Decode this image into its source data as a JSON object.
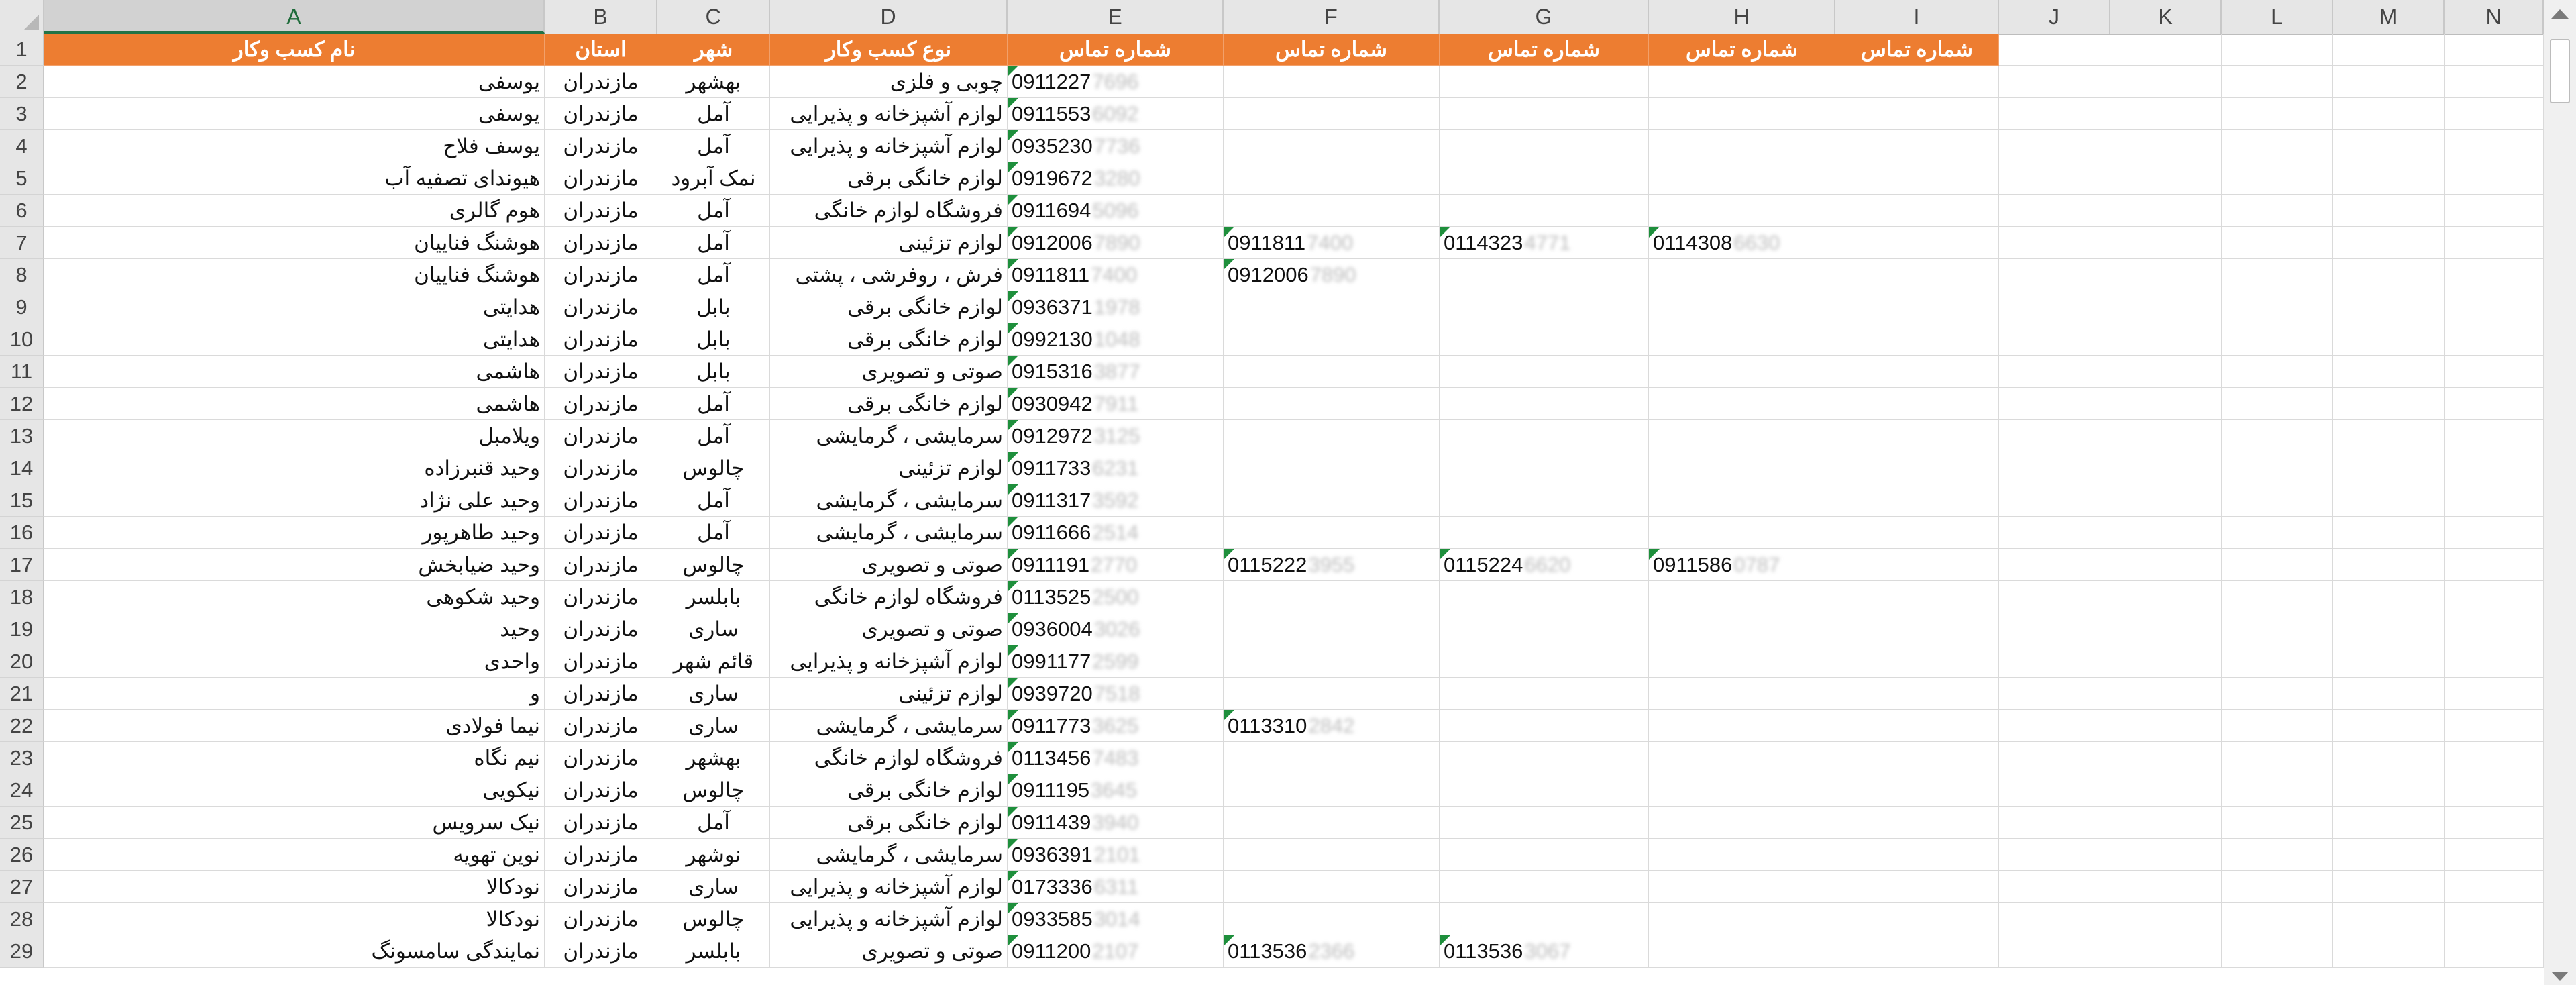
{
  "columns": [
    "A",
    "B",
    "C",
    "D",
    "E",
    "F",
    "G",
    "H",
    "I",
    "J",
    "K",
    "L",
    "M",
    "N"
  ],
  "header_row": {
    "row_number": "1",
    "A": "نام کسب وکار",
    "B": "استان",
    "C": "شهر",
    "D": "نوع کسب وکار",
    "E": "شماره تماس",
    "F": "شماره تماس",
    "G": "شماره تماس",
    "H": "شماره تماس",
    "I": "شماره تماس"
  },
  "rows": [
    {
      "n": "2",
      "A": "یوسفی",
      "B": "مازندران",
      "C": "بهشهر",
      "D": "چوبی و فلزی",
      "E": "0911227",
      "Eb": "7696",
      "F": "",
      "Fb": "",
      "G": "",
      "Gb": "",
      "H": "",
      "Hb": ""
    },
    {
      "n": "3",
      "A": "یوسفی",
      "B": "مازندران",
      "C": "آمل",
      "D": "لوازم آشپزخانه و پذیرایی",
      "E": "0911553",
      "Eb": "6092",
      "F": "",
      "Fb": "",
      "G": "",
      "Gb": "",
      "H": "",
      "Hb": ""
    },
    {
      "n": "4",
      "A": "یوسف فلاح",
      "B": "مازندران",
      "C": "آمل",
      "D": "لوازم آشپزخانه و پذیرایی",
      "E": "0935230",
      "Eb": "7736",
      "F": "",
      "Fb": "",
      "G": "",
      "Gb": "",
      "H": "",
      "Hb": ""
    },
    {
      "n": "5",
      "A": "هیوندای تصفیه آب",
      "B": "مازندران",
      "C": "نمک آبرود",
      "D": "لوازم خانگی برقی",
      "E": "0919672",
      "Eb": "3280",
      "F": "",
      "Fb": "",
      "G": "",
      "Gb": "",
      "H": "",
      "Hb": ""
    },
    {
      "n": "6",
      "A": "هوم گالری",
      "B": "مازندران",
      "C": "آمل",
      "D": "فروشگاه لوازم خانگی",
      "E": "0911694",
      "Eb": "5096",
      "F": "",
      "Fb": "",
      "G": "",
      "Gb": "",
      "H": "",
      "Hb": ""
    },
    {
      "n": "7",
      "A": "هوشنگ فناییان",
      "B": "مازندران",
      "C": "آمل",
      "D": "لوازم تزئینی",
      "E": "0912006",
      "Eb": "7890",
      "F": "0911811",
      "Fb": "7400",
      "G": "0114323",
      "Gb": "4771",
      "H": "0114308",
      "Hb": "6630"
    },
    {
      "n": "8",
      "A": "هوشنگ فناییان",
      "B": "مازندران",
      "C": "آمل",
      "D": "فرش ، روفرشی ، پشتی",
      "E": "0911811",
      "Eb": "7400",
      "F": "0912006",
      "Fb": "7890",
      "G": "",
      "Gb": "",
      "H": "",
      "Hb": ""
    },
    {
      "n": "9",
      "A": "هدایتی",
      "B": "مازندران",
      "C": "بابل",
      "D": "لوازم خانگی برقی",
      "E": "0936371",
      "Eb": "1978",
      "F": "",
      "Fb": "",
      "G": "",
      "Gb": "",
      "H": "",
      "Hb": ""
    },
    {
      "n": "10",
      "A": "هدایتی",
      "B": "مازندران",
      "C": "بابل",
      "D": "لوازم خانگی برقی",
      "E": "0992130",
      "Eb": "1048",
      "F": "",
      "Fb": "",
      "G": "",
      "Gb": "",
      "H": "",
      "Hb": ""
    },
    {
      "n": "11",
      "A": "هاشمی",
      "B": "مازندران",
      "C": "بابل",
      "D": "صوتی و تصویری",
      "E": "0915316",
      "Eb": "3877",
      "F": "",
      "Fb": "",
      "G": "",
      "Gb": "",
      "H": "",
      "Hb": ""
    },
    {
      "n": "12",
      "A": "هاشمی",
      "B": "مازندران",
      "C": "آمل",
      "D": "لوازم خانگی برقی",
      "E": "0930942",
      "Eb": "7911",
      "F": "",
      "Fb": "",
      "G": "",
      "Gb": "",
      "H": "",
      "Hb": ""
    },
    {
      "n": "13",
      "A": "ویلامبل",
      "B": "مازندران",
      "C": "آمل",
      "D": "سرمایشی ، گرمایشی",
      "E": "0912972",
      "Eb": "3125",
      "F": "",
      "Fb": "",
      "G": "",
      "Gb": "",
      "H": "",
      "Hb": ""
    },
    {
      "n": "14",
      "A": "وحید قنبرزاده",
      "B": "مازندران",
      "C": "چالوس",
      "D": "لوازم تزئینی",
      "E": "0911733",
      "Eb": "6231",
      "F": "",
      "Fb": "",
      "G": "",
      "Gb": "",
      "H": "",
      "Hb": ""
    },
    {
      "n": "15",
      "A": "وحید علی نژاد",
      "B": "مازندران",
      "C": "آمل",
      "D": "سرمایشی ، گرمایشی",
      "E": "0911317",
      "Eb": "3592",
      "F": "",
      "Fb": "",
      "G": "",
      "Gb": "",
      "H": "",
      "Hb": ""
    },
    {
      "n": "16",
      "A": "وحید طاهرپور",
      "B": "مازندران",
      "C": "آمل",
      "D": "سرمایشی ، گرمایشی",
      "E": "0911666",
      "Eb": "2514",
      "F": "",
      "Fb": "",
      "G": "",
      "Gb": "",
      "H": "",
      "Hb": ""
    },
    {
      "n": "17",
      "A": "وحید ضیابخش",
      "B": "مازندران",
      "C": "چالوس",
      "D": "صوتی و تصویری",
      "E": "0911191",
      "Eb": "2770",
      "F": "0115222",
      "Fb": "3955",
      "G": "0115224",
      "Gb": "6620",
      "H": "0911586",
      "Hb": "0787"
    },
    {
      "n": "18",
      "A": "وحید شکوهی",
      "B": "مازندران",
      "C": "بابلسر",
      "D": "فروشگاه لوازم خانگی",
      "E": "0113525",
      "Eb": "2500",
      "F": "",
      "Fb": "",
      "G": "",
      "Gb": "",
      "H": "",
      "Hb": ""
    },
    {
      "n": "19",
      "A": "وحید",
      "B": "مازندران",
      "C": "ساری",
      "D": "صوتی و تصویری",
      "E": "0936004",
      "Eb": "3026",
      "F": "",
      "Fb": "",
      "G": "",
      "Gb": "",
      "H": "",
      "Hb": ""
    },
    {
      "n": "20",
      "A": "واحدی",
      "B": "مازندران",
      "C": "قائم شهر",
      "D": "لوازم آشپزخانه و پذیرایی",
      "E": "0991177",
      "Eb": "2599",
      "F": "",
      "Fb": "",
      "G": "",
      "Gb": "",
      "H": "",
      "Hb": ""
    },
    {
      "n": "21",
      "A": "و",
      "B": "مازندران",
      "C": "ساری",
      "D": "لوازم تزئینی",
      "E": "0939720",
      "Eb": "7518",
      "F": "",
      "Fb": "",
      "G": "",
      "Gb": "",
      "H": "",
      "Hb": ""
    },
    {
      "n": "22",
      "A": "نیما فولادی",
      "B": "مازندران",
      "C": "ساری",
      "D": "سرمایشی ، گرمایشی",
      "E": "0911773",
      "Eb": "3625",
      "F": "0113310",
      "Fb": "2842",
      "G": "",
      "Gb": "",
      "H": "",
      "Hb": ""
    },
    {
      "n": "23",
      "A": "نیم نگاه",
      "B": "مازندران",
      "C": "بهشهر",
      "D": "فروشگاه لوازم خانگی",
      "E": "0113456",
      "Eb": "7483",
      "F": "",
      "Fb": "",
      "G": "",
      "Gb": "",
      "H": "",
      "Hb": ""
    },
    {
      "n": "24",
      "A": "نیکویی",
      "B": "مازندران",
      "C": "چالوس",
      "D": "لوازم خانگی برقی",
      "E": "0911195",
      "Eb": "3645",
      "F": "",
      "Fb": "",
      "G": "",
      "Gb": "",
      "H": "",
      "Hb": ""
    },
    {
      "n": "25",
      "A": "نیک سرویس",
      "B": "مازندران",
      "C": "آمل",
      "D": "لوازم خانگی برقی",
      "E": "0911439",
      "Eb": "3940",
      "F": "",
      "Fb": "",
      "G": "",
      "Gb": "",
      "H": "",
      "Hb": ""
    },
    {
      "n": "26",
      "A": "نوین تهویه",
      "B": "مازندران",
      "C": "نوشهر",
      "D": "سرمایشی ، گرمایشی",
      "E": "0936391",
      "Eb": "2101",
      "F": "",
      "Fb": "",
      "G": "",
      "Gb": "",
      "H": "",
      "Hb": ""
    },
    {
      "n": "27",
      "A": "نودکالا",
      "B": "مازندران",
      "C": "ساری",
      "D": "لوازم آشپزخانه و پذیرایی",
      "E": "0173336",
      "Eb": "6311",
      "F": "",
      "Fb": "",
      "G": "",
      "Gb": "",
      "H": "",
      "Hb": ""
    },
    {
      "n": "28",
      "A": "نودکالا",
      "B": "مازندران",
      "C": "چالوس",
      "D": "لوازم آشپزخانه و پذیرایی",
      "E": "0933585",
      "Eb": "3014",
      "F": "",
      "Fb": "",
      "G": "",
      "Gb": "",
      "H": "",
      "Hb": ""
    },
    {
      "n": "29",
      "A": "نمایندگی سامسونگ",
      "B": "مازندران",
      "C": "بابلسر",
      "D": "صوتی و تصویری",
      "E": "0911200",
      "Eb": "2107",
      "F": "0113536",
      "Fb": "2366",
      "G": "0113536",
      "Gb": "3067",
      "H": "",
      "Hb": ""
    }
  ],
  "colors": {
    "header_fill": "#ed7d31",
    "header_text": "#ffffff",
    "error_triangle": "#1e8f3c",
    "selected_column_accent": "#217346"
  }
}
